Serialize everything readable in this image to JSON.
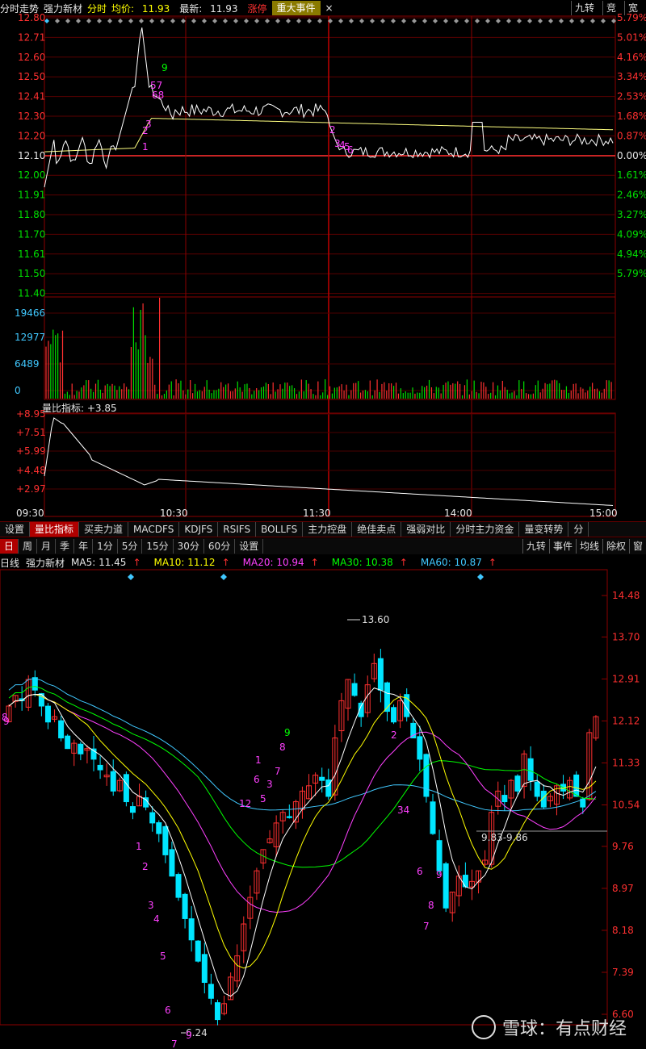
{
  "topbar": {
    "title": "分时走势",
    "stock": "强力新材",
    "mode": "分时",
    "avg_label": "均价:",
    "avg_value": "11.93",
    "last_label": "最新:",
    "last_value": "11.93",
    "limit_up": "涨停",
    "event_label": "重大事件",
    "close": "×",
    "right_buttons": [
      "九转",
      "竞",
      "宽"
    ]
  },
  "intraday": {
    "price_ticks": [
      "12.80",
      "12.71",
      "12.60",
      "12.50",
      "12.41",
      "12.30",
      "12.20",
      "12.10",
      "12.00",
      "11.91",
      "11.80",
      "11.70",
      "11.61",
      "11.50",
      "11.40"
    ],
    "pct_ticks": [
      "5.79%",
      "5.01%",
      "4.16%",
      "3.34%",
      "2.53%",
      "1.68%",
      "0.87%",
      "0.00%",
      "1.61%",
      "2.46%",
      "3.27%",
      "4.09%",
      "4.94%",
      "5.79%"
    ],
    "volume_ticks": [
      "19466",
      "12977",
      "6489",
      "0"
    ],
    "annotations": [
      "9",
      "57",
      "68",
      "3",
      "2",
      "1",
      "2",
      "3",
      "4",
      "5",
      "6"
    ]
  },
  "liangbi": {
    "title": "量比指标:",
    "value": "+3.85",
    "ticks": [
      "+8.95",
      "+7.51",
      "+5.99",
      "+4.48",
      "+2.97"
    ],
    "time_ticks": [
      "09:30",
      "10:30",
      "11:30",
      "14:00",
      "15:00"
    ]
  },
  "tabs": [
    "设置",
    "量比指标",
    "买卖力道",
    "MACDFS",
    "KDJFS",
    "RSIFS",
    "BOLLFS",
    "主力控盘",
    "绝佳卖点",
    "强弱对比",
    "分时主力资金",
    "量变转势",
    "分"
  ],
  "active_tab": "量比指标",
  "periods": [
    "日",
    "周",
    "月",
    "季",
    "年",
    "1分",
    "5分",
    "15分",
    "30分",
    "60分",
    "设置"
  ],
  "active_period": "日",
  "period_right": [
    "九转",
    "事件",
    "均线",
    "除权",
    "窗"
  ],
  "ma": {
    "label": "日线",
    "stock": "强力新材",
    "ma5": "MA5: 11.45",
    "ma10": "MA10: 11.12",
    "ma20": "MA20: 10.94",
    "ma30": "MA30: 10.38",
    "ma60": "MA60: 10.87",
    "arrow": "↑"
  },
  "daily": {
    "price_ticks": [
      "14.48",
      "13.70",
      "12.91",
      "12.12",
      "11.33",
      "10.54",
      "9.76",
      "8.97",
      "8.18",
      "7.39",
      "6.60"
    ],
    "high_mark": "13.60",
    "low_mark": "6.24",
    "range_mark": "9.83-9.86",
    "annotations": [
      "9",
      "8",
      "1",
      "2",
      "3",
      "4",
      "5",
      "6",
      "7",
      "9",
      "8",
      "7",
      "6",
      "5",
      "3",
      "12",
      "1",
      "2",
      "34",
      "6",
      "9",
      "8",
      "7"
    ]
  },
  "watermark": "雪球：有点财经",
  "colors": {
    "up": "#ff3030",
    "down": "#00e5ff",
    "ma5": "#ffffff",
    "ma10": "#ffff00",
    "ma20": "#ff40ff",
    "ma30": "#00ff00",
    "ma60": "#40c8ff"
  }
}
